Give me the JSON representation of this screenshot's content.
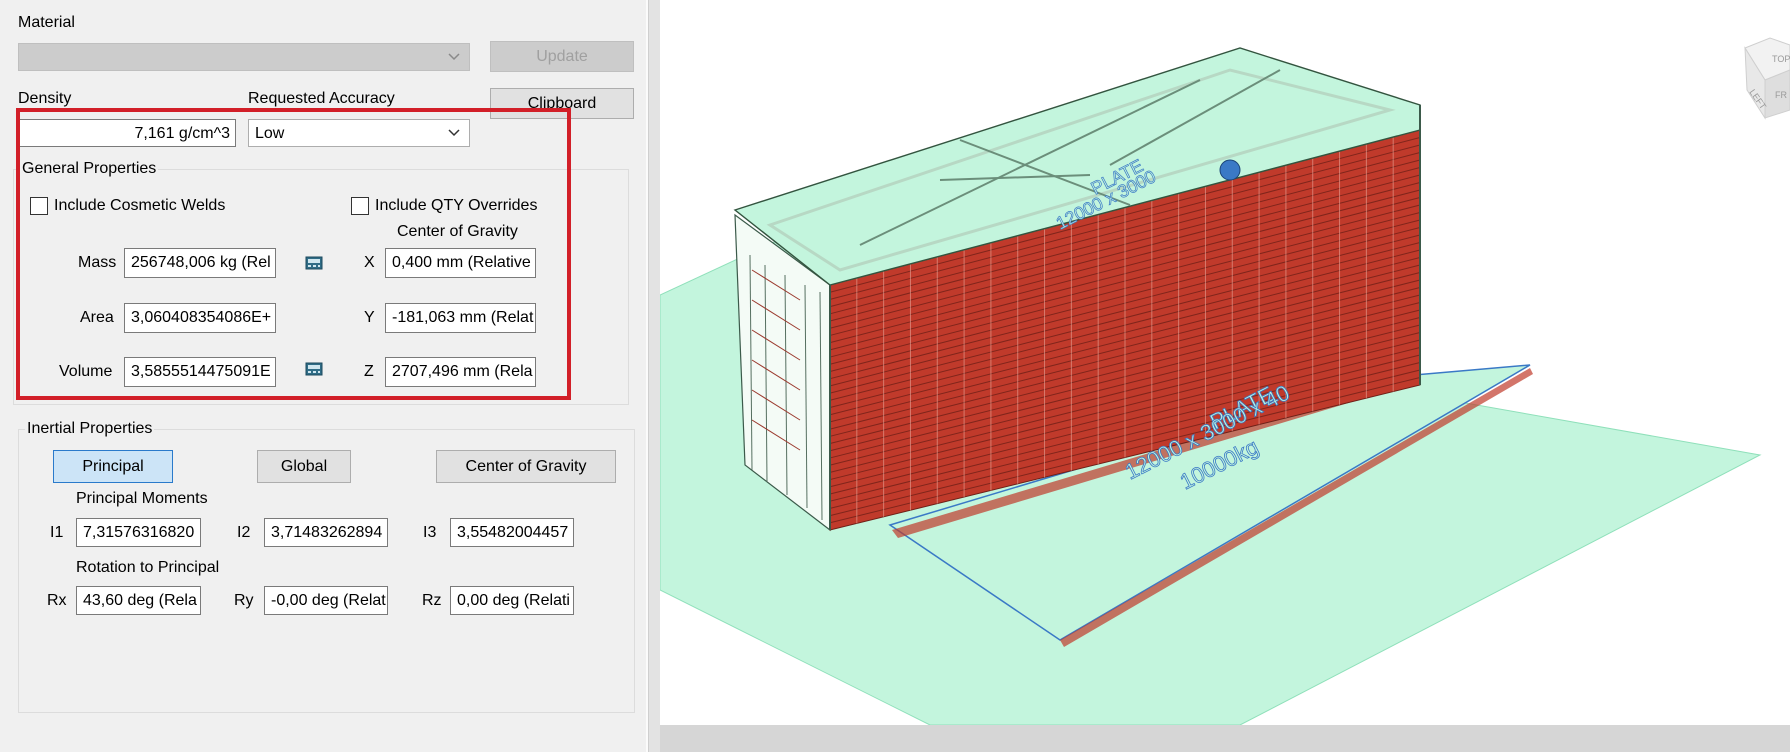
{
  "material": {
    "label": "Material",
    "combo_value": "",
    "update_label": "Update",
    "clipboard_label": "Clipboard"
  },
  "density": {
    "label": "Density",
    "value": "7,161 g/cm^3"
  },
  "accuracy": {
    "label": "Requested Accuracy",
    "value": "Low"
  },
  "general": {
    "title": "General Properties",
    "cosmetic_welds_label": "Include Cosmetic Welds",
    "cosmetic_welds_checked": false,
    "qty_overrides_label": "Include QTY Overrides",
    "qty_overrides_checked": false,
    "cog_title": "Center of Gravity",
    "mass_label": "Mass",
    "mass_value": "256748,006 kg (Rel",
    "area_label": "Area",
    "area_value": "3,060408354086E+",
    "volume_label": "Volume",
    "volume_value": "3,5855514475091E",
    "x_label": "X",
    "x_value": "0,400 mm (Relative",
    "y_label": "Y",
    "y_value": "-181,063 mm (Relat",
    "z_label": "Z",
    "z_value": "2707,496 mm (Rela"
  },
  "inertial": {
    "title": "Inertial Properties",
    "tabs": [
      "Principal",
      "Global",
      "Center of Gravity"
    ],
    "selected_tab": "Principal",
    "moments_title": "Principal Moments",
    "i1_label": "I1",
    "i1_value": "7,31576316820",
    "i2_label": "I2",
    "i2_value": "3,71483262894",
    "i3_label": "I3",
    "i3_value": "3,55482004457",
    "rotation_title": "Rotation to Principal",
    "rx_label": "Rx",
    "rx_value": "43,60 deg (Rela",
    "ry_label": "Ry",
    "ry_value": "-0,00 deg (Relat",
    "rz_label": "Rz",
    "rz_value": "0,00 deg (Relati"
  },
  "viewport": {
    "plate_large_text": [
      "PLATE",
      "12000 x 3000 x 40",
      "10000kg"
    ],
    "plate_top_text": [
      "PLATE",
      "12000 x 3000"
    ],
    "viewcube_faces": [
      "TOP",
      "LEFT",
      "FR"
    ],
    "ground_color": "#c3f5dd",
    "frame_color": "#b7d8c4",
    "shelf_color": "#c03a2b",
    "annotation_color": "#3a79c6",
    "highlight_color": "#d21f28"
  }
}
